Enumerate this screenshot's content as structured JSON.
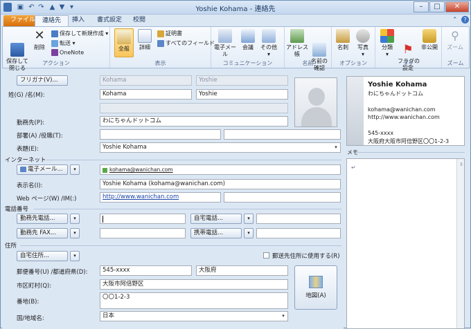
{
  "window": {
    "title": "Yoshie Kohama - 連絡先",
    "minimize": "–",
    "maximize": "□",
    "close": "✕"
  },
  "tabs": {
    "file": "ファイル",
    "contact": "連絡先",
    "insert": "挿入",
    "format": "書式設定",
    "review": "校閲"
  },
  "ribbon": {
    "save_close": "保存して\n閉じる",
    "delete": "削除",
    "save_new": "保存して新規作成",
    "forward": "転送",
    "onenote": "OneNote",
    "group_action": "アクション",
    "general": "全般",
    "detail": "詳細",
    "certificate": "証明書",
    "all_fields": "すべてのフィールド",
    "group_show": "表示",
    "email": "電子メール",
    "meeting": "会議",
    "other": "その他",
    "group_comm": "コミュニケーション",
    "address_book": "アドレス帳",
    "check_names": "名前の\n確認",
    "group_names": "名前",
    "business_card": "名刺",
    "picture": "写真",
    "group_options": "オプション",
    "categorize": "分類",
    "follow_up": "フラグの\n設定",
    "private": "非公開",
    "group_tags": "タグ",
    "zoom": "ズーム",
    "group_zoom": "ズーム"
  },
  "form": {
    "furigana_btn": "フリガナ(V)...",
    "furigana_last": "Kohama",
    "furigana_first": "Yoshie",
    "name_label": "姓(G) /名(M):",
    "last_name": "Kohama",
    "first_name": "Yoshie",
    "company_label": "勤務先(P):",
    "company": "わにちゃんドットコム",
    "dept_label": "部署(A) /役職(T):",
    "fileas_label": "表題(E):",
    "fileas": "Yoshie Kohama",
    "internet_section": "インターネット",
    "email_btn": "電子メール...",
    "email": "kohama@wanichan.com",
    "display_label": "表示名(I):",
    "display": "Yoshie Kohama (kohama@wanichan.com)",
    "web_label": "Web ページ(W) /IM(:)",
    "web": "http://www.wanichan.com",
    "phone_section": "電話番号",
    "work_phone_btn": "勤務先電話...",
    "home_phone_btn": "自宅電話...",
    "work_fax_btn": "勤務先 FAX...",
    "mobile_btn": "携帯電話...",
    "address_section": "住所",
    "home_addr_btn": "自宅住所...",
    "mailing_check": "郵送先住所に使用する(R)",
    "zip_label": "郵便番号(U) /都道府県(D):",
    "zip": "545-xxxx",
    "pref": "大阪府",
    "city_label": "市区町村(Q):",
    "city": "大阪市阿倍野区",
    "street_label": "番地(B):",
    "street": "〇〇1-2-3",
    "country_label": "国/地域名:",
    "country": "日本",
    "map_btn": "地図(A)"
  },
  "card": {
    "name": "Yoshie Kohama",
    "company": "わにちゃんドットコム",
    "email": "kohama@wanichan.com",
    "web": "http://www.wanichan.com",
    "zip": "545-xxxx",
    "address": "大阪府大阪市阿倍野区〇〇1-2-3"
  },
  "memo": {
    "label": "メモ",
    "content": "↵"
  }
}
